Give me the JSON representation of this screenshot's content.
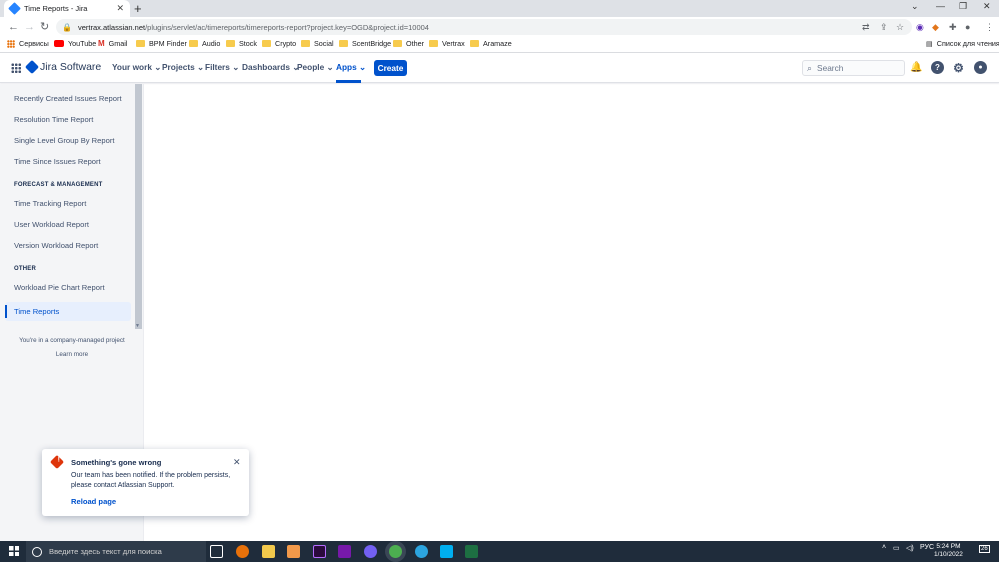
{
  "browser": {
    "tab_title": "Time Reports - Jira",
    "url_host": "vertrax.atlassian.net",
    "url_path": "/plugins/servlet/ac/timereports/timereports-report?project.key=OGD&project.id=10004",
    "reading_list": "Список для чтения",
    "bookmarks": [
      "Сервисы",
      "YouTube",
      "Gmail",
      "BPM Finder",
      "Audio",
      "Stock",
      "Crypto",
      "Social",
      "ScentBridge",
      "Other",
      "Vertrax",
      "Aramaze"
    ]
  },
  "jira": {
    "product": "Jira Software",
    "nav": [
      "Your work",
      "Projects",
      "Filters",
      "Dashboards",
      "People",
      "Apps"
    ],
    "active_nav": "Apps",
    "create_label": "Create",
    "search_placeholder": "Search"
  },
  "sidebar": {
    "items_top": [
      "Recently Created Issues Report",
      "Resolution Time Report",
      "Single Level Group By Report",
      "Time Since Issues Report"
    ],
    "heading_forecast": "FORECAST & MANAGEMENT",
    "items_forecast": [
      "Time Tracking Report",
      "User Workload Report",
      "Version Workload Report"
    ],
    "heading_other": "OTHER",
    "items_other": [
      "Workload Pie Chart Report"
    ],
    "active_item": "Time Reports",
    "project_note": "You're in a company-managed project",
    "learn_more": "Learn more"
  },
  "error_flag": {
    "title": "Something's gone wrong",
    "body": "Our team has been notified. If the problem persists, please contact Atlassian Support.",
    "action": "Reload page"
  },
  "taskbar": {
    "search_placeholder": "Введите здесь текст для поиска",
    "language": "РУС",
    "time": "5:24 PM",
    "date": "1/10/2022",
    "notifications": "26"
  },
  "colors": {
    "jira_blue": "#0052cc",
    "error_red": "#de350b",
    "sidebar_bg": "#f4f5f7"
  }
}
